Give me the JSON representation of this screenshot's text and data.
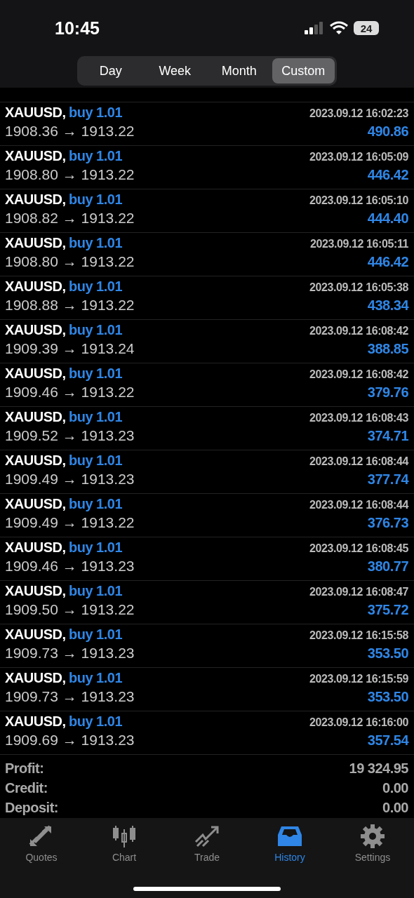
{
  "status_bar": {
    "time": "10:45",
    "battery": "24"
  },
  "periods": [
    {
      "label": "Day",
      "selected": false
    },
    {
      "label": "Week",
      "selected": false
    },
    {
      "label": "Month",
      "selected": false
    },
    {
      "label": "Custom",
      "selected": true
    }
  ],
  "deals": [
    {
      "symbol": "XAUUSD,",
      "side": "buy 1.01",
      "time": "2023.09.12 16:02:23",
      "prices": "1908.36 → 1913.22",
      "profit": "490.86"
    },
    {
      "symbol": "XAUUSD,",
      "side": "buy 1.01",
      "time": "2023.09.12 16:05:09",
      "prices": "1908.80 → 1913.22",
      "profit": "446.42"
    },
    {
      "symbol": "XAUUSD,",
      "side": "buy 1.01",
      "time": "2023.09.12 16:05:10",
      "prices": "1908.82 → 1913.22",
      "profit": "444.40"
    },
    {
      "symbol": "XAUUSD,",
      "side": "buy 1.01",
      "time": "2023.09.12 16:05:11",
      "prices": "1908.80 → 1913.22",
      "profit": "446.42"
    },
    {
      "symbol": "XAUUSD,",
      "side": "buy 1.01",
      "time": "2023.09.12 16:05:38",
      "prices": "1908.88 → 1913.22",
      "profit": "438.34"
    },
    {
      "symbol": "XAUUSD,",
      "side": "buy 1.01",
      "time": "2023.09.12 16:08:42",
      "prices": "1909.39 → 1913.24",
      "profit": "388.85"
    },
    {
      "symbol": "XAUUSD,",
      "side": "buy 1.01",
      "time": "2023.09.12 16:08:42",
      "prices": "1909.46 → 1913.22",
      "profit": "379.76"
    },
    {
      "symbol": "XAUUSD,",
      "side": "buy 1.01",
      "time": "2023.09.12 16:08:43",
      "prices": "1909.52 → 1913.23",
      "profit": "374.71"
    },
    {
      "symbol": "XAUUSD,",
      "side": "buy 1.01",
      "time": "2023.09.12 16:08:44",
      "prices": "1909.49 → 1913.23",
      "profit": "377.74"
    },
    {
      "symbol": "XAUUSD,",
      "side": "buy 1.01",
      "time": "2023.09.12 16:08:44",
      "prices": "1909.49 → 1913.22",
      "profit": "376.73"
    },
    {
      "symbol": "XAUUSD,",
      "side": "buy 1.01",
      "time": "2023.09.12 16:08:45",
      "prices": "1909.46 → 1913.23",
      "profit": "380.77"
    },
    {
      "symbol": "XAUUSD,",
      "side": "buy 1.01",
      "time": "2023.09.12 16:08:47",
      "prices": "1909.50 → 1913.22",
      "profit": "375.72"
    },
    {
      "symbol": "XAUUSD,",
      "side": "buy 1.01",
      "time": "2023.09.12 16:15:58",
      "prices": "1909.73 → 1913.23",
      "profit": "353.50"
    },
    {
      "symbol": "XAUUSD,",
      "side": "buy 1.01",
      "time": "2023.09.12 16:15:59",
      "prices": "1909.73 → 1913.23",
      "profit": "353.50"
    },
    {
      "symbol": "XAUUSD,",
      "side": "buy 1.01",
      "time": "2023.09.12 16:16:00",
      "prices": "1909.69 → 1913.23",
      "profit": "357.54"
    }
  ],
  "summary": [
    {
      "label": "Profit:",
      "value": "19 324.95"
    },
    {
      "label": "Credit:",
      "value": "0.00"
    },
    {
      "label": "Deposit:",
      "value": "0.00"
    }
  ],
  "tab_bar": [
    {
      "kind": "quotes",
      "label": "Quotes",
      "selected": false
    },
    {
      "kind": "chart",
      "label": "Chart",
      "selected": false
    },
    {
      "kind": "trade",
      "label": "Trade",
      "selected": false
    },
    {
      "kind": "history",
      "label": "History",
      "selected": true
    },
    {
      "kind": "settings",
      "label": "Settings",
      "selected": false
    }
  ]
}
